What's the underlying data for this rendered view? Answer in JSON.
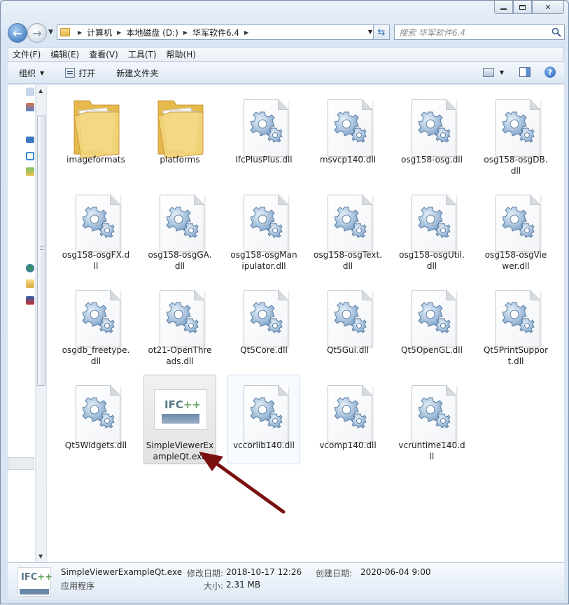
{
  "window": {
    "caption": {
      "minimize": "▭",
      "maximize": "▣",
      "close": "✕"
    }
  },
  "address": {
    "crumbs": [
      "计算机",
      "本地磁盘 (D:)",
      "华军软件6.4"
    ]
  },
  "search": {
    "placeholder": "搜索 华军软件6.4"
  },
  "menu": [
    "文件(F)",
    "编辑(E)",
    "查看(V)",
    "工具(T)",
    "帮助(H)"
  ],
  "toolbar": {
    "organize": "组织",
    "open": "打开",
    "new_folder": "新建文件夹"
  },
  "files": [
    {
      "name": "imageformats",
      "type": "folder"
    },
    {
      "name": "platforms",
      "type": "folder"
    },
    {
      "name": "IfcPlusPlus.dll",
      "type": "dll"
    },
    {
      "name": "msvcp140.dll",
      "type": "dll"
    },
    {
      "name": "osg158-osg.dll",
      "type": "dll"
    },
    {
      "name": "osg158-osgDB.dll",
      "type": "dll"
    },
    {
      "name": "osg158-osgFX.dll",
      "type": "dll"
    },
    {
      "name": "osg158-osgGA.dll",
      "type": "dll"
    },
    {
      "name": "osg158-osgManipulator.dll",
      "type": "dll"
    },
    {
      "name": "osg158-osgText.dll",
      "type": "dll"
    },
    {
      "name": "osg158-osgUtil.dll",
      "type": "dll"
    },
    {
      "name": "osg158-osgViewer.dll",
      "type": "dll"
    },
    {
      "name": "osgdb_freetype.dll",
      "type": "dll"
    },
    {
      "name": "ot21-OpenThreads.dll",
      "type": "dll"
    },
    {
      "name": "Qt5Core.dll",
      "type": "dll"
    },
    {
      "name": "Qt5Gui.dll",
      "type": "dll"
    },
    {
      "name": "Qt5OpenGL.dll",
      "type": "dll"
    },
    {
      "name": "Qt5PrintSupport.dll",
      "type": "dll"
    },
    {
      "name": "Qt5Widgets.dll",
      "type": "dll"
    },
    {
      "name": "SimpleViewerExampleQt.exe",
      "type": "exe",
      "state": "selected"
    },
    {
      "name": "vccorlib140.dll",
      "type": "dll",
      "state": "hover"
    },
    {
      "name": "vcomp140.dll",
      "type": "dll"
    },
    {
      "name": "vcruntime140.dll",
      "type": "dll"
    }
  ],
  "exe_icon_text": {
    "a": "IFC",
    "b": "++"
  },
  "details": {
    "name": "SimpleViewerExampleQt.exe",
    "type": "应用程序",
    "modified_label": "修改日期:",
    "modified_value": "2018-10-17 12:26",
    "size_label": "大小:",
    "size_value": "2.31 MB",
    "created_label": "创建日期:",
    "created_value": "2020-06-04 9:00"
  },
  "colors": {
    "annotation_arrow": "#7a1010",
    "selection": "#e4e4e4",
    "hover_border": "#cfe0f5"
  }
}
